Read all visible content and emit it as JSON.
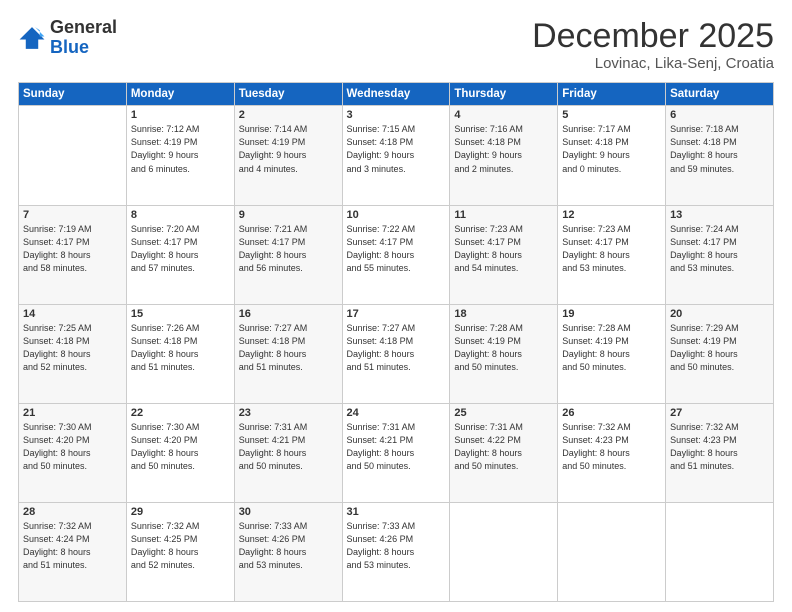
{
  "header": {
    "logo_line1": "General",
    "logo_line2": "Blue",
    "month": "December 2025",
    "location": "Lovinac, Lika-Senj, Croatia"
  },
  "weekdays": [
    "Sunday",
    "Monday",
    "Tuesday",
    "Wednesday",
    "Thursday",
    "Friday",
    "Saturday"
  ],
  "weeks": [
    [
      {
        "day": "",
        "info": ""
      },
      {
        "day": "1",
        "info": "Sunrise: 7:12 AM\nSunset: 4:19 PM\nDaylight: 9 hours\nand 6 minutes."
      },
      {
        "day": "2",
        "info": "Sunrise: 7:14 AM\nSunset: 4:19 PM\nDaylight: 9 hours\nand 4 minutes."
      },
      {
        "day": "3",
        "info": "Sunrise: 7:15 AM\nSunset: 4:18 PM\nDaylight: 9 hours\nand 3 minutes."
      },
      {
        "day": "4",
        "info": "Sunrise: 7:16 AM\nSunset: 4:18 PM\nDaylight: 9 hours\nand 2 minutes."
      },
      {
        "day": "5",
        "info": "Sunrise: 7:17 AM\nSunset: 4:18 PM\nDaylight: 9 hours\nand 0 minutes."
      },
      {
        "day": "6",
        "info": "Sunrise: 7:18 AM\nSunset: 4:18 PM\nDaylight: 8 hours\nand 59 minutes."
      }
    ],
    [
      {
        "day": "7",
        "info": "Sunrise: 7:19 AM\nSunset: 4:17 PM\nDaylight: 8 hours\nand 58 minutes."
      },
      {
        "day": "8",
        "info": "Sunrise: 7:20 AM\nSunset: 4:17 PM\nDaylight: 8 hours\nand 57 minutes."
      },
      {
        "day": "9",
        "info": "Sunrise: 7:21 AM\nSunset: 4:17 PM\nDaylight: 8 hours\nand 56 minutes."
      },
      {
        "day": "10",
        "info": "Sunrise: 7:22 AM\nSunset: 4:17 PM\nDaylight: 8 hours\nand 55 minutes."
      },
      {
        "day": "11",
        "info": "Sunrise: 7:23 AM\nSunset: 4:17 PM\nDaylight: 8 hours\nand 54 minutes."
      },
      {
        "day": "12",
        "info": "Sunrise: 7:23 AM\nSunset: 4:17 PM\nDaylight: 8 hours\nand 53 minutes."
      },
      {
        "day": "13",
        "info": "Sunrise: 7:24 AM\nSunset: 4:17 PM\nDaylight: 8 hours\nand 53 minutes."
      }
    ],
    [
      {
        "day": "14",
        "info": "Sunrise: 7:25 AM\nSunset: 4:18 PM\nDaylight: 8 hours\nand 52 minutes."
      },
      {
        "day": "15",
        "info": "Sunrise: 7:26 AM\nSunset: 4:18 PM\nDaylight: 8 hours\nand 51 minutes."
      },
      {
        "day": "16",
        "info": "Sunrise: 7:27 AM\nSunset: 4:18 PM\nDaylight: 8 hours\nand 51 minutes."
      },
      {
        "day": "17",
        "info": "Sunrise: 7:27 AM\nSunset: 4:18 PM\nDaylight: 8 hours\nand 51 minutes."
      },
      {
        "day": "18",
        "info": "Sunrise: 7:28 AM\nSunset: 4:19 PM\nDaylight: 8 hours\nand 50 minutes."
      },
      {
        "day": "19",
        "info": "Sunrise: 7:28 AM\nSunset: 4:19 PM\nDaylight: 8 hours\nand 50 minutes."
      },
      {
        "day": "20",
        "info": "Sunrise: 7:29 AM\nSunset: 4:19 PM\nDaylight: 8 hours\nand 50 minutes."
      }
    ],
    [
      {
        "day": "21",
        "info": "Sunrise: 7:30 AM\nSunset: 4:20 PM\nDaylight: 8 hours\nand 50 minutes."
      },
      {
        "day": "22",
        "info": "Sunrise: 7:30 AM\nSunset: 4:20 PM\nDaylight: 8 hours\nand 50 minutes."
      },
      {
        "day": "23",
        "info": "Sunrise: 7:31 AM\nSunset: 4:21 PM\nDaylight: 8 hours\nand 50 minutes."
      },
      {
        "day": "24",
        "info": "Sunrise: 7:31 AM\nSunset: 4:21 PM\nDaylight: 8 hours\nand 50 minutes."
      },
      {
        "day": "25",
        "info": "Sunrise: 7:31 AM\nSunset: 4:22 PM\nDaylight: 8 hours\nand 50 minutes."
      },
      {
        "day": "26",
        "info": "Sunrise: 7:32 AM\nSunset: 4:23 PM\nDaylight: 8 hours\nand 50 minutes."
      },
      {
        "day": "27",
        "info": "Sunrise: 7:32 AM\nSunset: 4:23 PM\nDaylight: 8 hours\nand 51 minutes."
      }
    ],
    [
      {
        "day": "28",
        "info": "Sunrise: 7:32 AM\nSunset: 4:24 PM\nDaylight: 8 hours\nand 51 minutes."
      },
      {
        "day": "29",
        "info": "Sunrise: 7:32 AM\nSunset: 4:25 PM\nDaylight: 8 hours\nand 52 minutes."
      },
      {
        "day": "30",
        "info": "Sunrise: 7:33 AM\nSunset: 4:26 PM\nDaylight: 8 hours\nand 53 minutes."
      },
      {
        "day": "31",
        "info": "Sunrise: 7:33 AM\nSunset: 4:26 PM\nDaylight: 8 hours\nand 53 minutes."
      },
      {
        "day": "",
        "info": ""
      },
      {
        "day": "",
        "info": ""
      },
      {
        "day": "",
        "info": ""
      }
    ]
  ]
}
